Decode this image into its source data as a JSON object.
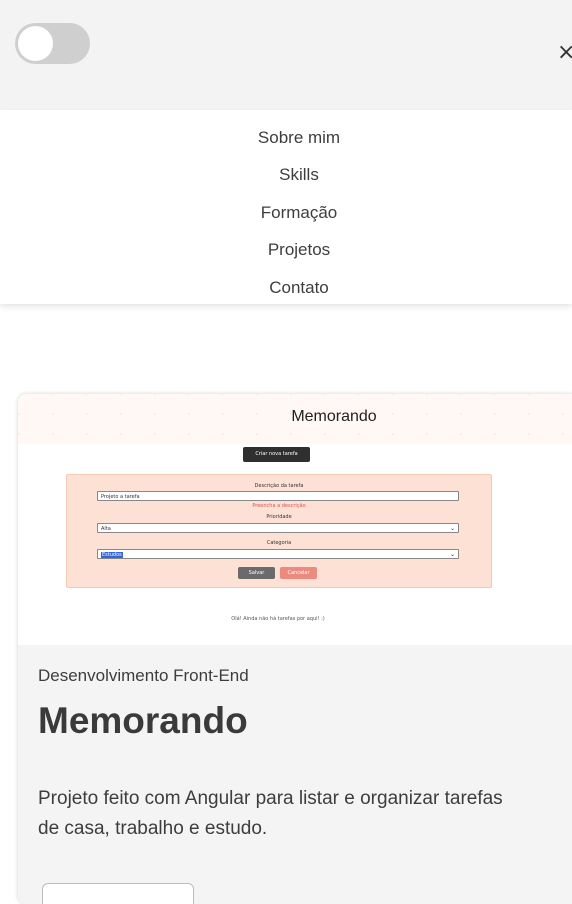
{
  "header": {
    "close_glyph": "×"
  },
  "menu": {
    "items": [
      {
        "label": "Sobre mim"
      },
      {
        "label": "Skills"
      },
      {
        "label": "Formação"
      },
      {
        "label": "Projetos"
      },
      {
        "label": "Contato"
      }
    ]
  },
  "project": {
    "screenshot": {
      "title": "Memorando",
      "new_task_button": "Criar nova tarefa",
      "description_label": "Descrição da tarefa",
      "description_value": "Projeto a tarefa",
      "description_error": "Preencha a descrição",
      "priority_label": "Prioridade",
      "priority_value": "Alta",
      "category_label": "Categoria",
      "category_value": "Estudos",
      "save_button": "Salvar",
      "cancel_button": "Cancelar",
      "empty_message": "Olá! Ainda não há tarefas por aqui! :)"
    },
    "category": "Desenvolvimento Front-End",
    "title": "Memorando",
    "description": "Projeto feito com Angular para listar e organizar tarefas de casa, trabalho e estudo."
  }
}
